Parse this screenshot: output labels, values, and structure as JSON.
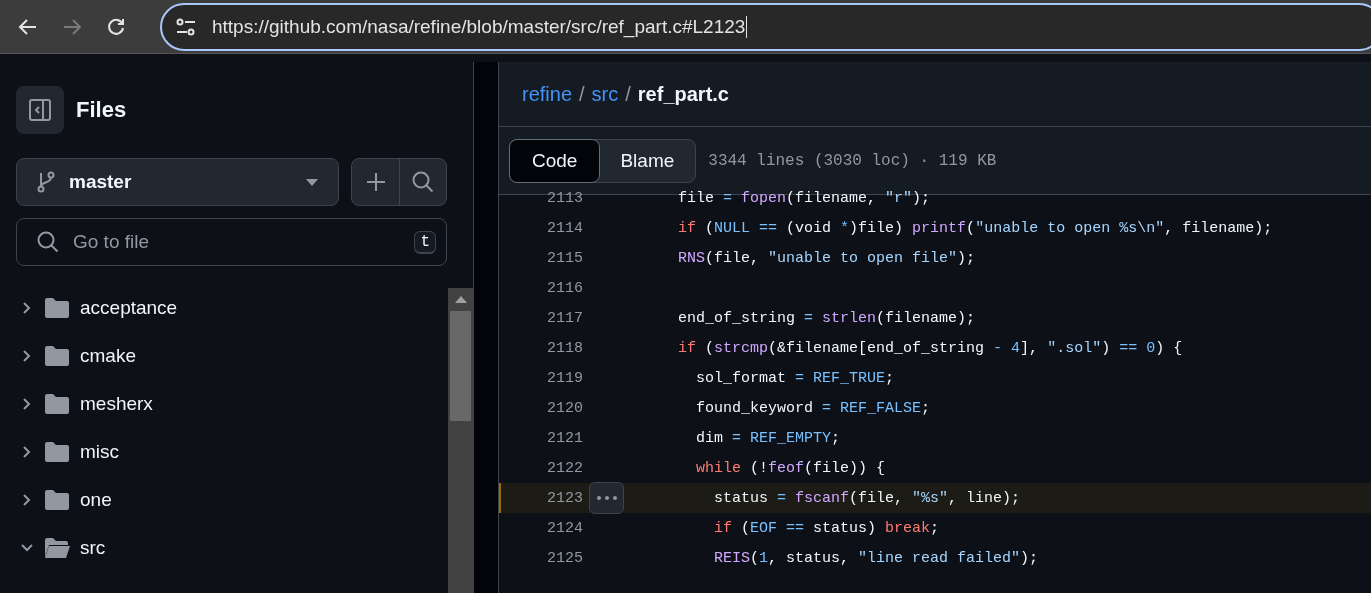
{
  "browser": {
    "nav": [
      {
        "kind": "back",
        "disabled": false
      },
      {
        "kind": "forward",
        "disabled": true
      },
      {
        "kind": "reload",
        "disabled": false
      }
    ],
    "url": "https://github.com/nasa/refine/blob/master/src/ref_part.c#L2123"
  },
  "sidebar": {
    "title": "Files",
    "branch": "master",
    "search": {
      "placeholder": "Go to file",
      "shortcut": "t"
    },
    "tree": [
      {
        "name": "acceptance",
        "expanded": false
      },
      {
        "name": "cmake",
        "expanded": false
      },
      {
        "name": "mesherx",
        "expanded": false
      },
      {
        "name": "misc",
        "expanded": false
      },
      {
        "name": "one",
        "expanded": false
      },
      {
        "name": "src",
        "expanded": true
      }
    ]
  },
  "file": {
    "separator": "/",
    "breadcrumb": [
      {
        "text": "refine",
        "link": true
      },
      {
        "text": "src",
        "link": true
      },
      {
        "text": "ref_part.c",
        "link": false
      }
    ],
    "tabs": [
      {
        "label": "Code",
        "selected": true
      },
      {
        "label": "Blame",
        "selected": false
      }
    ],
    "info": "3344 lines (3030 loc) · 119 KB",
    "lines": [
      {
        "number": "2113",
        "highlighted": false,
        "tokens": [
          {
            "kind": "plain",
            "text": "file "
          },
          {
            "kind": "const",
            "text": "= "
          },
          {
            "kind": "func",
            "text": "fopen"
          },
          {
            "kind": "plain",
            "text": "(filename, "
          },
          {
            "kind": "string",
            "text": "\"r\""
          },
          {
            "kind": "plain",
            "text": ");"
          }
        ]
      },
      {
        "number": "2114",
        "highlighted": false,
        "tokens": [
          {
            "kind": "keyword",
            "text": "if"
          },
          {
            "kind": "plain",
            "text": " ("
          },
          {
            "kind": "const",
            "text": "NULL =="
          },
          {
            "kind": "plain",
            "text": " (void "
          },
          {
            "kind": "const",
            "text": "*"
          },
          {
            "kind": "plain",
            "text": ")file) "
          },
          {
            "kind": "func",
            "text": "printf"
          },
          {
            "kind": "plain",
            "text": "("
          },
          {
            "kind": "string",
            "text": "\"unable to open %s\\n\""
          },
          {
            "kind": "plain",
            "text": ", filename);"
          }
        ]
      },
      {
        "number": "2115",
        "highlighted": false,
        "tokens": [
          {
            "kind": "func",
            "text": "RNS"
          },
          {
            "kind": "plain",
            "text": "(file, "
          },
          {
            "kind": "string",
            "text": "\"unable to open file\""
          },
          {
            "kind": "plain",
            "text": ");"
          }
        ]
      },
      {
        "number": "2116",
        "highlighted": false
      },
      {
        "number": "2117",
        "highlighted": false,
        "tokens": [
          {
            "kind": "plain",
            "text": "end_of_string "
          },
          {
            "kind": "const",
            "text": "= "
          },
          {
            "kind": "func",
            "text": "strlen"
          },
          {
            "kind": "plain",
            "text": "(filename);"
          }
        ]
      },
      {
        "number": "2118",
        "highlighted": false,
        "tokens": [
          {
            "kind": "keyword",
            "text": "if"
          },
          {
            "kind": "plain",
            "text": " ("
          },
          {
            "kind": "func",
            "text": "strcmp"
          },
          {
            "kind": "plain",
            "text": "(&filename[end_of_string "
          },
          {
            "kind": "const",
            "text": "- 4"
          },
          {
            "kind": "plain",
            "text": "], "
          },
          {
            "kind": "string",
            "text": "\".sol\""
          },
          {
            "kind": "plain",
            "text": ") "
          },
          {
            "kind": "const",
            "text": "== 0"
          },
          {
            "kind": "plain",
            "text": ") {"
          }
        ]
      },
      {
        "number": "2119",
        "highlighted": false,
        "tokens": [
          {
            "kind": "plain",
            "text": "  sol_format "
          },
          {
            "kind": "const",
            "text": "= REF_TRUE"
          },
          {
            "kind": "plain",
            "text": ";"
          }
        ]
      },
      {
        "number": "2120",
        "highlighted": false,
        "tokens": [
          {
            "kind": "plain",
            "text": "  found_keyword "
          },
          {
            "kind": "const",
            "text": "= REF_FALSE"
          },
          {
            "kind": "plain",
            "text": ";"
          }
        ]
      },
      {
        "number": "2121",
        "highlighted": false,
        "tokens": [
          {
            "kind": "plain",
            "text": "  dim "
          },
          {
            "kind": "const",
            "text": "= REF_EMPTY"
          },
          {
            "kind": "plain",
            "text": ";"
          }
        ]
      },
      {
        "number": "2122",
        "highlighted": false,
        "tokens": [
          {
            "kind": "keyword",
            "text": "  while"
          },
          {
            "kind": "plain",
            "text": " (!"
          },
          {
            "kind": "func",
            "text": "feof"
          },
          {
            "kind": "plain",
            "text": "(file)) {"
          }
        ]
      },
      {
        "number": "2123",
        "highlighted": true,
        "tokens": [
          {
            "kind": "plain",
            "text": "    status "
          },
          {
            "kind": "const",
            "text": "= "
          },
          {
            "kind": "func",
            "text": "fscanf"
          },
          {
            "kind": "plain",
            "text": "(file, "
          },
          {
            "kind": "string",
            "text": "\"%s\""
          },
          {
            "kind": "plain",
            "text": ", line);"
          }
        ]
      },
      {
        "number": "2124",
        "highlighted": false,
        "tokens": [
          {
            "kind": "keyword",
            "text": "    if"
          },
          {
            "kind": "plain",
            "text": " ("
          },
          {
            "kind": "const",
            "text": "EOF =="
          },
          {
            "kind": "plain",
            "text": " status) "
          },
          {
            "kind": "keyword",
            "text": "break"
          },
          {
            "kind": "plain",
            "text": ";"
          }
        ]
      },
      {
        "number": "2125",
        "highlighted": false,
        "tokens": [
          {
            "kind": "func",
            "text": "    REIS"
          },
          {
            "kind": "plain",
            "text": "("
          },
          {
            "kind": "const",
            "text": "1"
          },
          {
            "kind": "plain",
            "text": ", status, "
          },
          {
            "kind": "string",
            "text": "\"line read failed\""
          },
          {
            "kind": "plain",
            "text": ");"
          }
        ]
      }
    ]
  }
}
